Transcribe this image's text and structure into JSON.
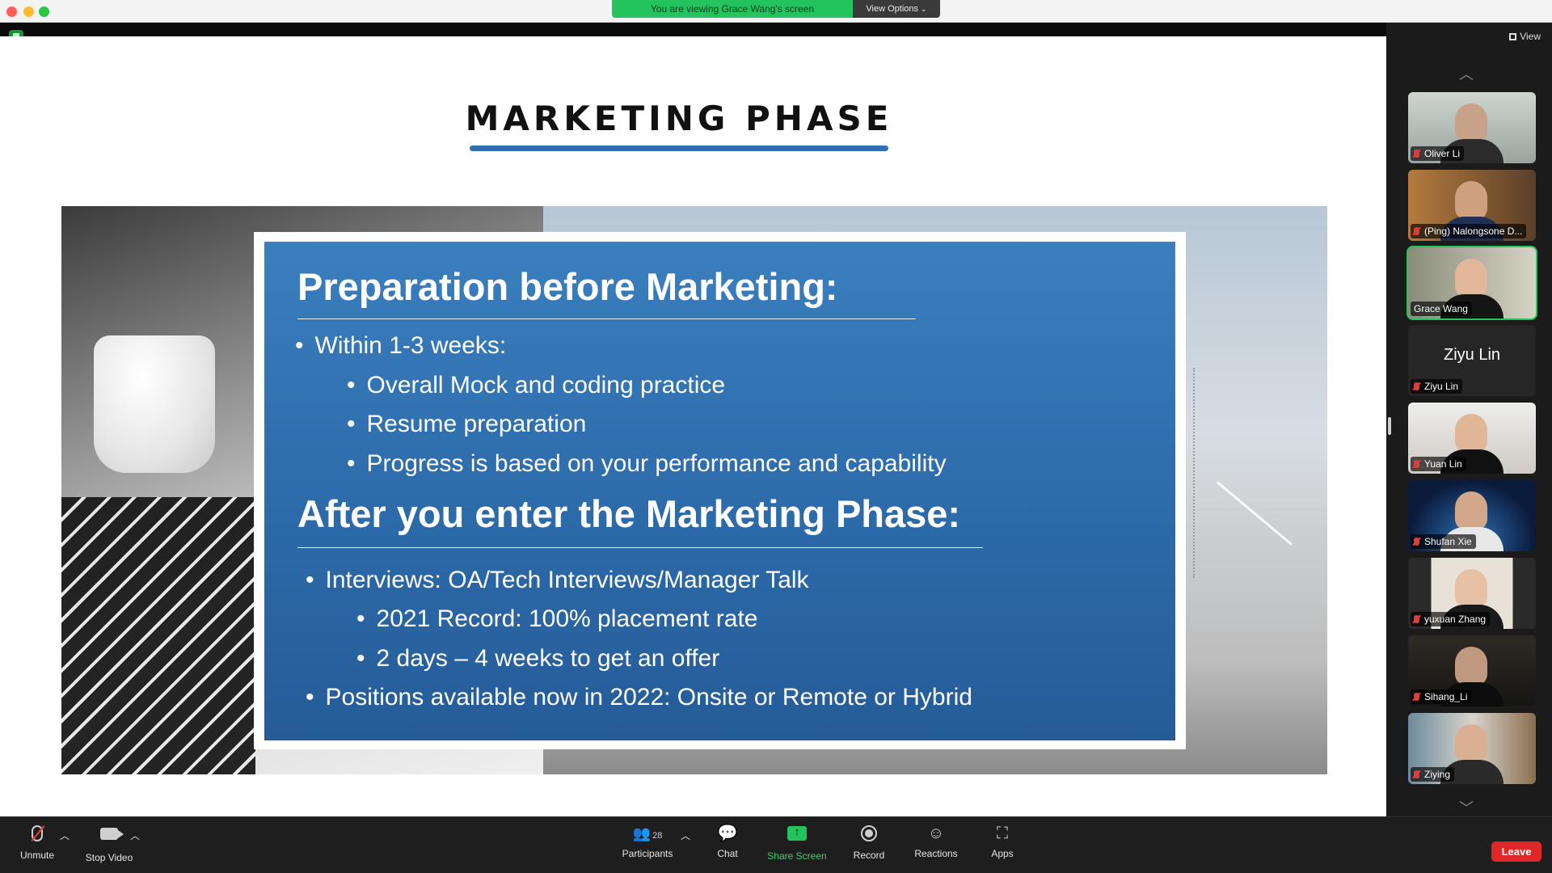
{
  "window": {
    "viewing_banner": "You are viewing Grace Wang's screen",
    "view_options": "View Options",
    "view_button": "View"
  },
  "slide": {
    "title": "MARKETING PHASE",
    "heading_1": "Preparation before Marketing:",
    "heading_2": "After you enter the Marketing Phase:",
    "bullets_1": [
      {
        "level": 1,
        "text": "Within 1-3 weeks:"
      },
      {
        "level": 2,
        "text": "Overall Mock and coding practice"
      },
      {
        "level": 2,
        "text": "Resume preparation"
      },
      {
        "level": 2,
        "text": "Progress is based on your performance and capability"
      }
    ],
    "bullets_2": [
      {
        "level": 1,
        "text": "Interviews: OA/Tech Interviews/Manager Talk"
      },
      {
        "level": 2,
        "text": "2021 Record: 100% placement rate"
      },
      {
        "level": 2,
        "text": "2 days – 4 weeks to get an offer"
      },
      {
        "level": 1,
        "text": "Positions available now in 2022: Onsite or Remote or Hybrid"
      }
    ],
    "accent_color": "#2f6eb0"
  },
  "participants_panel": {
    "tiles": [
      {
        "name": "Oliver Li",
        "muted": true,
        "video": true
      },
      {
        "name": "(Ping) Nalongsone D...",
        "muted": true,
        "video": true
      },
      {
        "name": "Grace Wang",
        "muted": false,
        "video": true,
        "active_speaker": true
      },
      {
        "name": "Ziyu Lin",
        "muted": true,
        "video": false,
        "display_name": "Ziyu Lin"
      },
      {
        "name": "Yuan Lin",
        "muted": true,
        "video": true
      },
      {
        "name": "Shufan Xie",
        "muted": true,
        "video": true
      },
      {
        "name": "yuxuan Zhang",
        "muted": true,
        "video": true
      },
      {
        "name": "Sihang_Li",
        "muted": true,
        "video": true
      },
      {
        "name": "Ziying",
        "muted": true,
        "video": true
      }
    ]
  },
  "toolbar": {
    "unmute": "Unmute",
    "stop_video": "Stop Video",
    "participants": "Participants",
    "participants_count": "28",
    "chat": "Chat",
    "share_screen": "Share Screen",
    "record": "Record",
    "reactions": "Reactions",
    "apps": "Apps",
    "leave": "Leave"
  },
  "colors": {
    "share_green": "#23c45e",
    "leave_red": "#e02828"
  }
}
